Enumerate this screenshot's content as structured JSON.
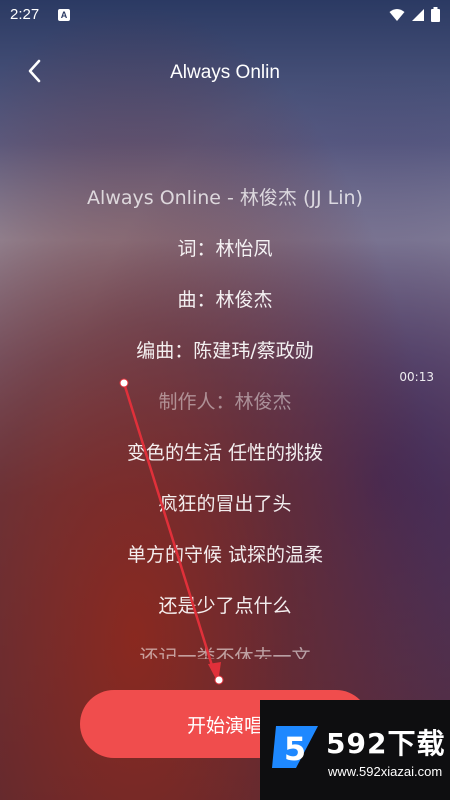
{
  "status_bar": {
    "time": "2:27",
    "badge": "A"
  },
  "header": {
    "title": "Always Onlin"
  },
  "lyrics": [
    "Always Online - 林俊杰 (JJ Lin)",
    "词：林怡凤",
    "曲：林俊杰",
    "编曲：陈建玮/蔡政勋",
    "制作人：林俊杰",
    "变色的生活 任性的挑拨",
    "疯狂的冒出了头",
    "单方的守候 试探的温柔",
    "还是少了点什么",
    "还记一类不休去一文"
  ],
  "current_time": "00:13",
  "start_button": {
    "label": "开始演唱"
  },
  "watermark": {
    "logo_text": "5",
    "brand": "592下载",
    "url": "www.592xiazai.com"
  },
  "colors": {
    "button": "#f04d4d",
    "arrow": "#e0303a"
  }
}
